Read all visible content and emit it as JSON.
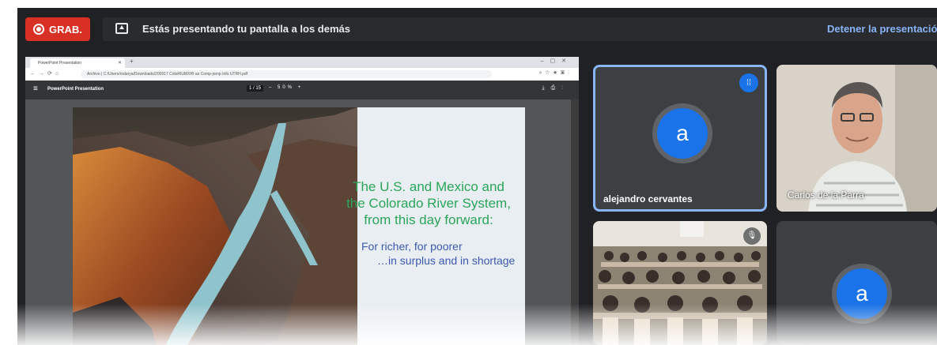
{
  "recording": {
    "label": "GRAB."
  },
  "presenting": {
    "message": "Estás presentando tu pantalla a los demás",
    "stop_label": "Detener la presentació"
  },
  "browser": {
    "tab_title": "PowerPoint Presentation",
    "address": "Archivo | C:/Users/rodarya/Downloads/200917 ColoRIUMXRI as Comp-jornp Info UTRH.pdf"
  },
  "pdf_viewer": {
    "title": "PowerPoint Presentation",
    "page_indicator": "1 / 15",
    "zoom": "– 50% +"
  },
  "slide": {
    "title": "The U.S. and Mexico and the Colorado River System, from this day forward:",
    "subtitle_line1": "For richer, for poorer",
    "subtitle_line2": "…in surplus and in shortage"
  },
  "participants": [
    {
      "name": "alejandro cervantes",
      "initial": "a"
    },
    {
      "name": "Carlos de la Parra"
    },
    {
      "name": ""
    },
    {
      "initial": "a"
    }
  ],
  "icons": {
    "record": "record-icon",
    "present": "present-screen-icon",
    "speaking": "speaking-indicator-icon",
    "mic_off": "mic-off-icon"
  },
  "colors": {
    "record_red": "#d93025",
    "link_blue": "#8ab4f8",
    "avatar_blue": "#1a73e8",
    "slide_title_green": "#2aa55a",
    "slide_sub_blue": "#3c59b0",
    "meet_bg": "#202124"
  }
}
